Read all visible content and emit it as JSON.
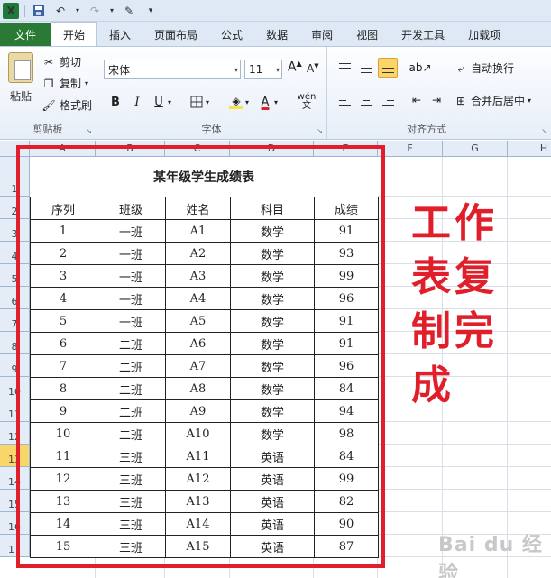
{
  "ribbon": {
    "tabs": [
      "文件",
      "开始",
      "插入",
      "页面布局",
      "公式",
      "数据",
      "审阅",
      "视图",
      "开发工具",
      "加载项"
    ],
    "active_tab": "开始",
    "clipboard": {
      "paste": "粘贴",
      "cut": "剪切",
      "copy": "复制",
      "format_painter": "格式刷",
      "group_label": "剪贴板"
    },
    "font": {
      "name": "宋体",
      "size": "11",
      "grow": "A",
      "shrink": "A",
      "bold": "B",
      "italic": "I",
      "underline": "U",
      "font_color_letter": "A",
      "wen": "wén",
      "group_label": "字体",
      "highlight_color": "#f7e34b",
      "font_color": "#e01f2b"
    },
    "alignment": {
      "wrap_text": "自动换行",
      "merge_center": "合并后居中",
      "group_label": "对齐方式"
    }
  },
  "sheet": {
    "columns": [
      "A",
      "B",
      "C",
      "D",
      "E",
      "F",
      "G",
      "H"
    ],
    "rows": [
      "1",
      "2",
      "3",
      "4",
      "5",
      "6",
      "7",
      "8",
      "9",
      "10",
      "11",
      "12",
      "13",
      "14",
      "15",
      "16",
      "17"
    ],
    "selected_row": "13",
    "title": "某年级学生成绩表",
    "headers": [
      "序列",
      "班级",
      "姓名",
      "科目",
      "成绩"
    ],
    "records": [
      [
        "1",
        "一班",
        "A1",
        "数学",
        "91"
      ],
      [
        "2",
        "一班",
        "A2",
        "数学",
        "93"
      ],
      [
        "3",
        "一班",
        "A3",
        "数学",
        "99"
      ],
      [
        "4",
        "一班",
        "A4",
        "数学",
        "96"
      ],
      [
        "5",
        "一班",
        "A5",
        "数学",
        "91"
      ],
      [
        "6",
        "二班",
        "A6",
        "数学",
        "91"
      ],
      [
        "7",
        "二班",
        "A7",
        "数学",
        "96"
      ],
      [
        "8",
        "二班",
        "A8",
        "数学",
        "84"
      ],
      [
        "9",
        "二班",
        "A9",
        "数学",
        "94"
      ],
      [
        "10",
        "二班",
        "A10",
        "数学",
        "98"
      ],
      [
        "11",
        "三班",
        "A11",
        "英语",
        "84"
      ],
      [
        "12",
        "三班",
        "A12",
        "英语",
        "99"
      ],
      [
        "13",
        "三班",
        "A13",
        "英语",
        "82"
      ],
      [
        "14",
        "三班",
        "A14",
        "英语",
        "90"
      ],
      [
        "15",
        "三班",
        "A15",
        "英语",
        "87"
      ]
    ]
  },
  "annotation": {
    "text": "工作表复制完成",
    "color": "#e01f2b"
  },
  "watermark": "Bai du 经验"
}
